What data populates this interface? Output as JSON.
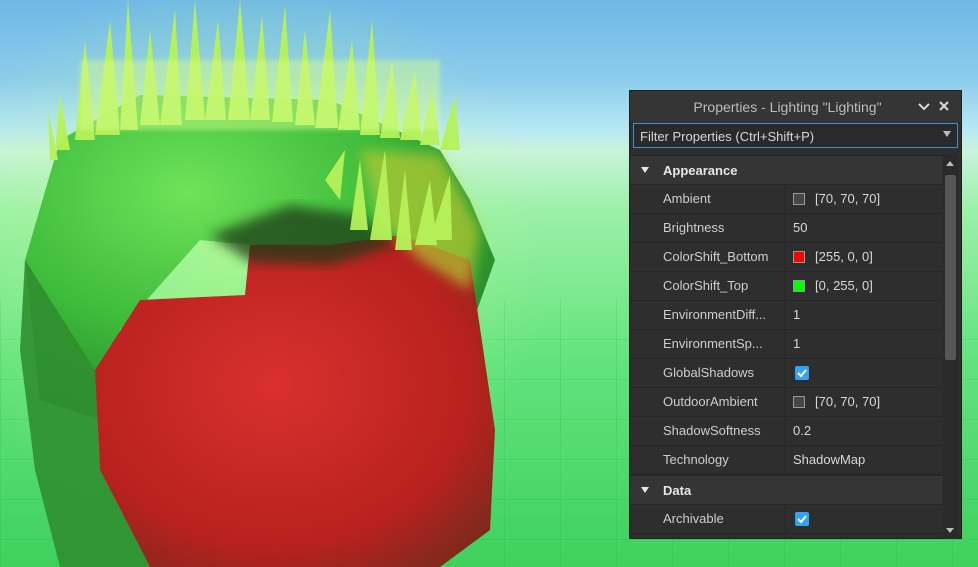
{
  "panel": {
    "title": "Properties - Lighting \"Lighting\"",
    "collapse_icon": "chevron-down-icon",
    "close_icon": "close-icon",
    "filter_placeholder": "Filter Properties (Ctrl+Shift+P)"
  },
  "sections": {
    "appearance": {
      "label": "Appearance",
      "rows": [
        {
          "name": "Ambient",
          "value": "[70, 70, 70]",
          "swatch": "#464646"
        },
        {
          "name": "Brightness",
          "value": "50"
        },
        {
          "name": "ColorShift_Bottom",
          "value": "[255, 0, 0]",
          "swatch": "#ff0000"
        },
        {
          "name": "ColorShift_Top",
          "value": "[0, 255, 0]",
          "swatch": "#00ff00"
        },
        {
          "name": "EnvironmentDiff...",
          "value": "1"
        },
        {
          "name": "EnvironmentSp...",
          "value": "1"
        },
        {
          "name": "GlobalShadows",
          "checked": true
        },
        {
          "name": "OutdoorAmbient",
          "value": "[70, 70, 70]",
          "swatch": "#464646"
        },
        {
          "name": "ShadowSoftness",
          "value": "0.2"
        },
        {
          "name": "Technology",
          "value": "ShadowMap"
        }
      ]
    },
    "data": {
      "label": "Data",
      "rows": [
        {
          "name": "Archivable",
          "checked": true
        }
      ]
    }
  },
  "colors": {
    "accent": "#35a2f2",
    "panel_bg": "#2e2e2e",
    "focus_border": "#3b8fd8"
  }
}
